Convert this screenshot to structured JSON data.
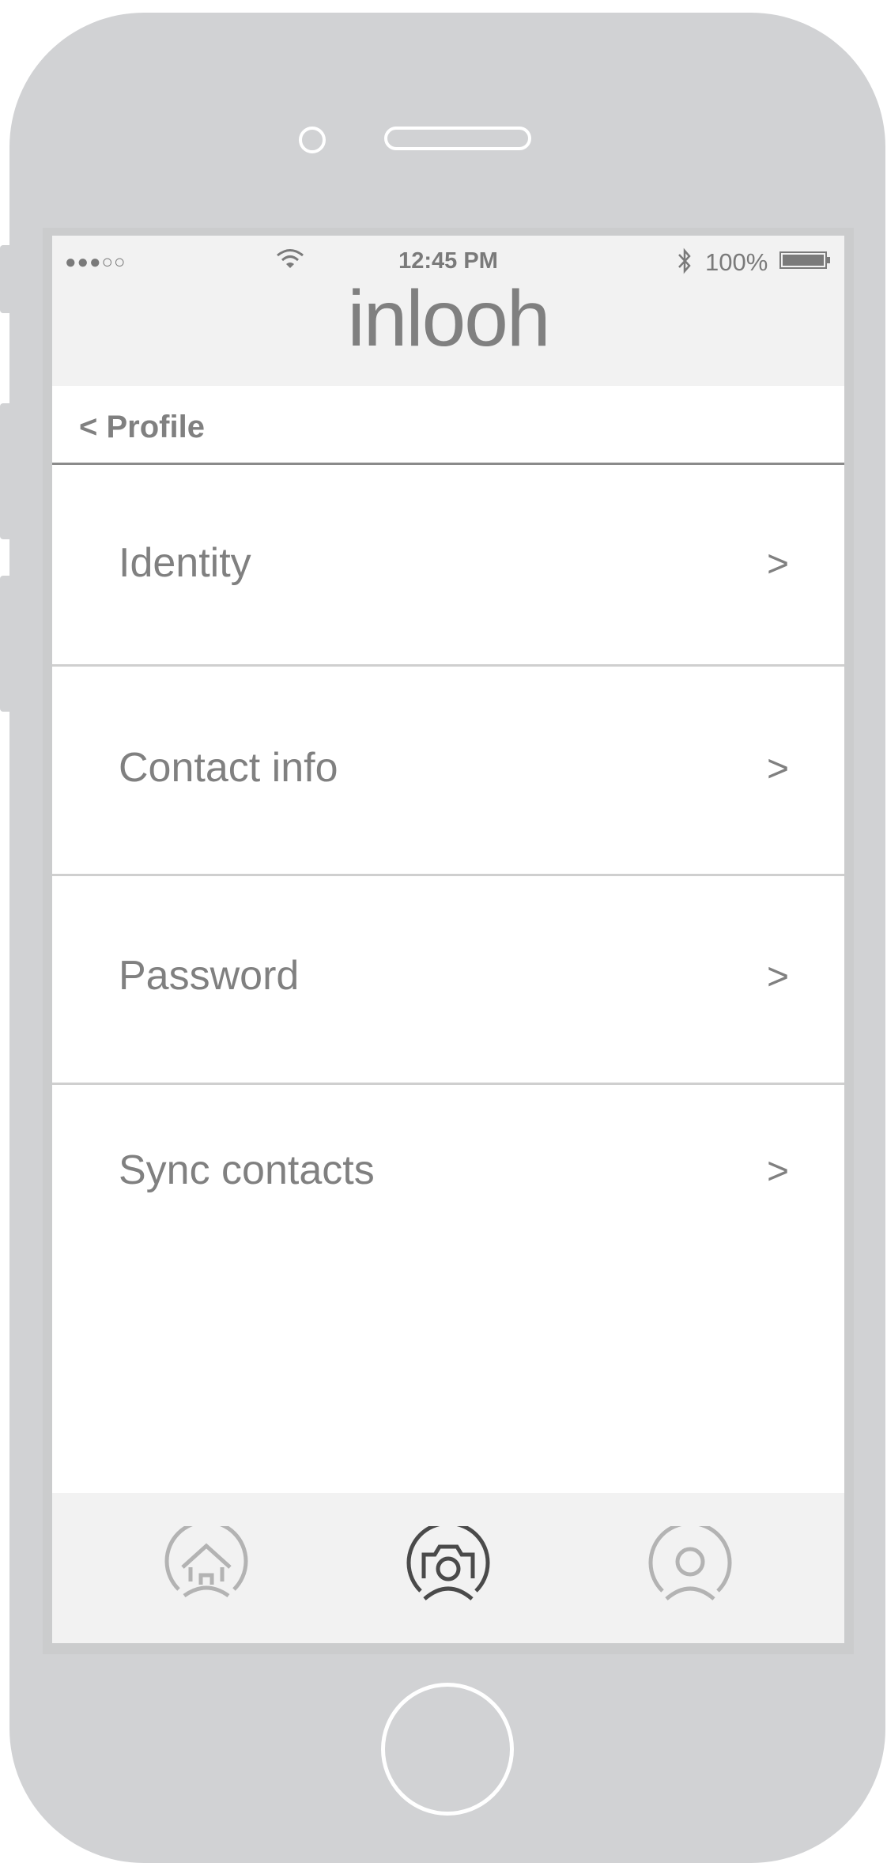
{
  "status_bar": {
    "signal": "●●●○○",
    "time": "12:45 PM",
    "battery_percent": "100%",
    "battery_level": 1.0,
    "icons": [
      "wifi-icon",
      "bluetooth-icon",
      "battery-icon"
    ]
  },
  "header": {
    "logo_text": "inlooh"
  },
  "nav": {
    "back_label": "< Profile"
  },
  "settings": {
    "items": [
      {
        "label": "Identity",
        "chevron": ">"
      },
      {
        "label": "Contact info",
        "chevron": ">"
      },
      {
        "label": "Password",
        "chevron": ">"
      },
      {
        "label": "Sync contacts",
        "chevron": ">"
      }
    ]
  },
  "tab_bar": {
    "tabs": [
      {
        "icon": "home-icon",
        "active": false
      },
      {
        "icon": "camera-icon",
        "active": true
      },
      {
        "icon": "profile-icon",
        "active": false
      }
    ],
    "colors": {
      "active": "#4a4a4a",
      "inactive": "#b3b3b3"
    }
  }
}
